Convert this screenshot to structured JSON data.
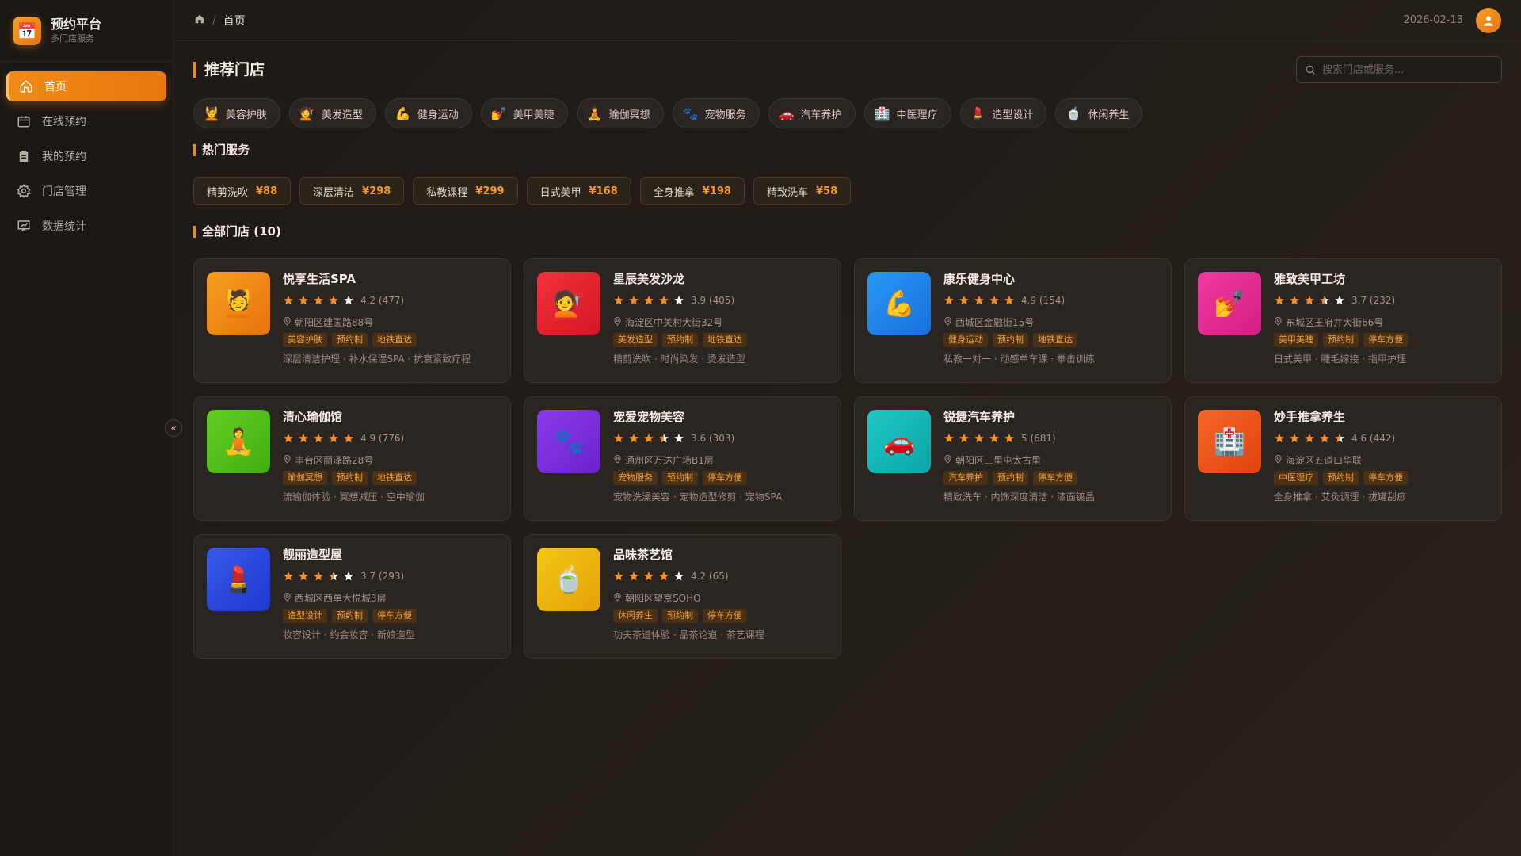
{
  "brand": {
    "title": "预约平台",
    "subtitle": "多门店服务",
    "logo_icon": "calendar-icon",
    "logo_glyph": "📅"
  },
  "nav": [
    {
      "label": "首页",
      "icon": "home-icon",
      "active": true
    },
    {
      "label": "在线预约",
      "icon": "calendar-icon",
      "active": false
    },
    {
      "label": "我的预约",
      "icon": "clipboard-icon",
      "active": false
    },
    {
      "label": "门店管理",
      "icon": "gear-icon",
      "active": false
    },
    {
      "label": "数据统计",
      "icon": "chart-icon",
      "active": false
    }
  ],
  "topbar": {
    "breadcrumb": "首页",
    "date": "2026-02-13"
  },
  "main": {
    "title": "推荐门店",
    "search_placeholder": "搜索门店或服务...",
    "categories": [
      {
        "emoji": "💆",
        "label": "美容护肤"
      },
      {
        "emoji": "💇",
        "label": "美发造型"
      },
      {
        "emoji": "💪",
        "label": "健身运动"
      },
      {
        "emoji": "💅",
        "label": "美甲美睫"
      },
      {
        "emoji": "🧘",
        "label": "瑜伽冥想"
      },
      {
        "emoji": "🐾",
        "label": "宠物服务"
      },
      {
        "emoji": "🚗",
        "label": "汽车养护"
      },
      {
        "emoji": "🏥",
        "label": "中医理疗"
      },
      {
        "emoji": "💄",
        "label": "造型设计"
      },
      {
        "emoji": "🍵",
        "label": "休闲养生"
      }
    ],
    "hot_title": "热门服务",
    "hot_services": [
      {
        "name": "精剪洗吹",
        "price": "¥88"
      },
      {
        "name": "深层清洁",
        "price": "¥298"
      },
      {
        "name": "私教课程",
        "price": "¥299"
      },
      {
        "name": "日式美甲",
        "price": "¥168"
      },
      {
        "name": "全身推拿",
        "price": "¥198"
      },
      {
        "name": "精致洗车",
        "price": "¥58"
      }
    ],
    "all_title": "全部门店 (10)",
    "stores": [
      {
        "name": "悦享生活SPA",
        "emoji": "💆",
        "rating": 4.2,
        "rating_text": "4.2 (477)",
        "address": "朝阳区建国路88号",
        "tags": [
          "美容护肤",
          "预约制",
          "地铁直达"
        ],
        "desc": "深层清洁护理 · 补水保湿SPA · 抗衰紧致疗程",
        "color_from": "#f6a01f",
        "color_to": "#e8720e"
      },
      {
        "name": "星辰美发沙龙",
        "emoji": "💇",
        "rating": 3.9,
        "rating_text": "3.9 (405)",
        "address": "海淀区中关村大街32号",
        "tags": [
          "美发造型",
          "预约制",
          "地铁直达"
        ],
        "desc": "精剪洗吹 · 时尚染发 · 烫发造型",
        "color_from": "#f0323a",
        "color_to": "#d41625"
      },
      {
        "name": "康乐健身中心",
        "emoji": "💪",
        "rating": 4.9,
        "rating_text": "4.9 (154)",
        "address": "西城区金融街15号",
        "tags": [
          "健身运动",
          "预约制",
          "地铁直达"
        ],
        "desc": "私教一对一 · 动感单车课 · 拳击训练",
        "color_from": "#2a97f5",
        "color_to": "#1670dc"
      },
      {
        "name": "雅致美甲工坊",
        "emoji": "💅",
        "rating": 3.7,
        "rating_text": "3.7 (232)",
        "address": "东城区王府井大街66号",
        "tags": [
          "美甲美睫",
          "预约制",
          "停车方便"
        ],
        "desc": "日式美甲 · 睫毛嫁接 · 指甲护理",
        "color_from": "#f03aa2",
        "color_to": "#d41e82"
      },
      {
        "name": "清心瑜伽馆",
        "emoji": "🧘",
        "rating": 4.9,
        "rating_text": "4.9 (776)",
        "address": "丰台区丽泽路28号",
        "tags": [
          "瑜伽冥想",
          "预约制",
          "地铁直达"
        ],
        "desc": "流瑜伽体验 · 冥想减压 · 空中瑜伽",
        "color_from": "#62cf22",
        "color_to": "#42ad12"
      },
      {
        "name": "宠爱宠物美容",
        "emoji": "🐾",
        "rating": 3.6,
        "rating_text": "3.6 (303)",
        "address": "通州区万达广场B1层",
        "tags": [
          "宠物服务",
          "预约制",
          "停车方便"
        ],
        "desc": "宠物洗澡美容 · 宠物造型修剪 · 宠物SPA",
        "color_from": "#8a3bea",
        "color_to": "#6a22cc"
      },
      {
        "name": "锐捷汽车养护",
        "emoji": "🚗",
        "rating": 5,
        "rating_text": "5 (681)",
        "address": "朝阳区三里屯太古里",
        "tags": [
          "汽车养护",
          "预约制",
          "停车方便"
        ],
        "desc": "精致洗车 · 内饰深度清洁 · 漆面镀晶",
        "color_from": "#1dc8c6",
        "color_to": "#0fa4a6"
      },
      {
        "name": "妙手推拿养生",
        "emoji": "🏥",
        "rating": 4.6,
        "rating_text": "4.6 (442)",
        "address": "海淀区五道口华联",
        "tags": [
          "中医理疗",
          "预约制",
          "停车方便"
        ],
        "desc": "全身推拿 · 艾灸调理 · 拔罐刮痧",
        "color_from": "#f6672a",
        "color_to": "#df420e"
      },
      {
        "name": "靓丽造型屋",
        "emoji": "💄",
        "rating": 3.7,
        "rating_text": "3.7 (293)",
        "address": "西城区西单大悦城3层",
        "tags": [
          "造型设计",
          "预约制",
          "停车方便"
        ],
        "desc": "妆容设计 · 约会妆容 · 新娘造型",
        "color_from": "#3a58ea",
        "color_to": "#1e38cc"
      },
      {
        "name": "品味茶艺馆",
        "emoji": "🍵",
        "rating": 4.2,
        "rating_text": "4.2 (65)",
        "address": "朝阳区望京SOHO",
        "tags": [
          "休闲养生",
          "预约制",
          "停车方便"
        ],
        "desc": "功夫茶道体验 · 品茶论道 · 茶艺课程",
        "color_from": "#f5c814",
        "color_to": "#e3a10a"
      }
    ]
  },
  "colors": {
    "accent": "#f08a16",
    "star_filled": "#f3912a",
    "star_empty": "#ffffff"
  }
}
